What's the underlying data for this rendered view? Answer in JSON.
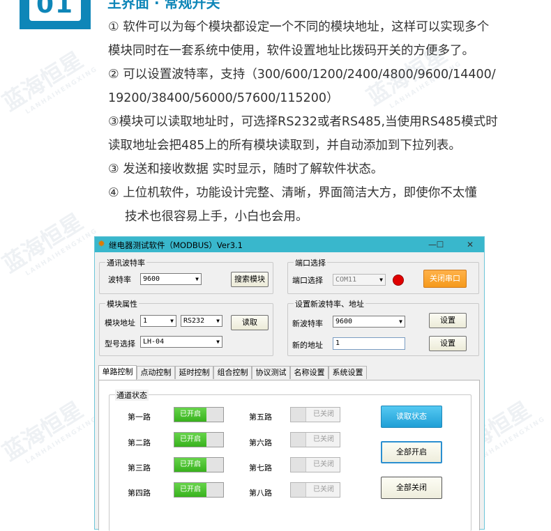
{
  "header": {
    "badge_number": "01",
    "heading": "主界面 · 常规开关"
  },
  "intro": {
    "lines": [
      "① 软件可以为每个模块都设定一个不同的模块地址，这样可以实现多个",
      "模块同时在一套系统中使用，软件设置地址比拨码开关的方便多了。",
      "② 可以设置波特率，支持（300/600/1200/2400/4800/9600/14400/",
      "19200/38400/56000/57600/115200）",
      "③模块可以读取地址时，可选择RS232或者RS485,当使用RS485模式时",
      "读取地址会把485上的所有模块读取到，并自动添加到下拉列表。",
      "③ 发送和接收数据 实时显示，随时了解软件状态。",
      "④ 上位机软件，功能设计完整、清晰，界面简洁大方，即使你不太懂",
      "技术也很容易上手，小白也会用。"
    ]
  },
  "watermark": {
    "cn": "蓝海恒星",
    "en": "LANHAIHENGXING"
  },
  "window": {
    "title": "继电器测试软件（MODBUS）Ver3.1",
    "icon": "gear-icon",
    "controls": {
      "minimize": "—",
      "maximize": "☐",
      "close": "✕"
    },
    "baud_group": {
      "title": "通讯波特率",
      "baud_label": "波特率",
      "baud_value": "9600",
      "search_button": "搜索模块"
    },
    "port_group": {
      "title": "端口选择",
      "port_label": "端口选择",
      "port_value": "COM11",
      "status_color": "#e00000",
      "close_port_button": "关闭串口"
    },
    "module_group": {
      "title": "模块属性",
      "address_label": "模块地址",
      "address_value": "1",
      "mode_value": "RS232",
      "read_button": "读取",
      "model_label": "型号选择",
      "model_value": "LH-04"
    },
    "new_group": {
      "title": "设置新波特率、地址",
      "new_baud_label": "新波特率",
      "new_baud_value": "9600",
      "set_baud_button": "设置",
      "new_address_label": "新的地址",
      "new_address_value": "1",
      "set_address_button": "设置"
    },
    "tabs": [
      "单路控制",
      "点动控制",
      "延时控制",
      "组合控制",
      "协议测试",
      "名称设置",
      "系统设置"
    ],
    "channel_group": {
      "title": "通道状态",
      "on_text": "已开启",
      "off_text": "已关闭",
      "channels": [
        {
          "label": "第一路",
          "state": "on"
        },
        {
          "label": "第二路",
          "state": "on"
        },
        {
          "label": "第三路",
          "state": "on"
        },
        {
          "label": "第四路",
          "state": "on"
        },
        {
          "label": "第五路",
          "state": "off"
        },
        {
          "label": "第六路",
          "state": "off"
        },
        {
          "label": "第七路",
          "state": "off"
        },
        {
          "label": "第八路",
          "state": "off"
        }
      ],
      "read_status_button": "读取状态",
      "all_on_button": "全部开启",
      "all_off_button": "全部关闭"
    }
  }
}
